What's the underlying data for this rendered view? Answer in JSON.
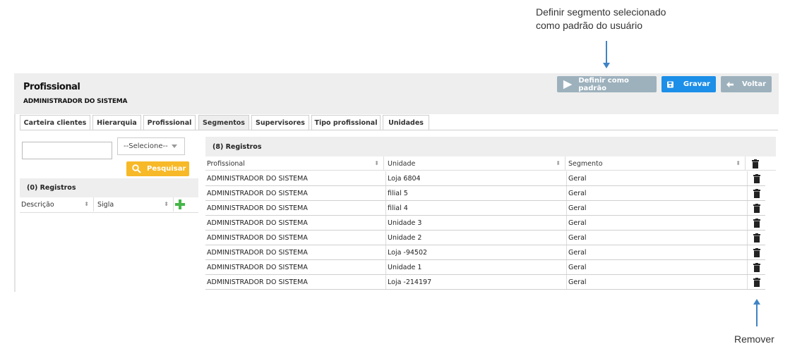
{
  "callouts": {
    "top_line1": "Definir segmento selecionado",
    "top_line2": "como padrão do usuário",
    "bottom": "Remover"
  },
  "header": {
    "title": "Profissional",
    "subtitle": "ADMINISTRADOR DO SISTEMA",
    "buttons": {
      "set_default": "Definir como padrão",
      "save": "Gravar",
      "back": "Voltar"
    }
  },
  "tabs": [
    {
      "label": "Carteira clientes",
      "active": false
    },
    {
      "label": "Hierarquia",
      "active": false
    },
    {
      "label": "Profissional",
      "active": false
    },
    {
      "label": "Segmentos",
      "active": true
    },
    {
      "label": "Supervisores",
      "active": false
    },
    {
      "label": "Tipo profissional",
      "active": false
    },
    {
      "label": "Unidades",
      "active": false
    }
  ],
  "left": {
    "search_value": "",
    "select_value": "--Selecione--",
    "search_button": "Pesquisar",
    "records_label": "(0) Registros",
    "columns": [
      "Descrição",
      "Sigla"
    ]
  },
  "right": {
    "records_label": "(8) Registros",
    "columns": [
      "Profissional",
      "Unidade",
      "Segmento"
    ],
    "rows": [
      {
        "profissional": "ADMINISTRADOR DO SISTEMA",
        "unidade": "Loja 6804",
        "segmento": "Geral"
      },
      {
        "profissional": "ADMINISTRADOR DO SISTEMA",
        "unidade": "filial 5",
        "segmento": "Geral"
      },
      {
        "profissional": "ADMINISTRADOR DO SISTEMA",
        "unidade": "filial 4",
        "segmento": "Geral"
      },
      {
        "profissional": "ADMINISTRADOR DO SISTEMA",
        "unidade": "Unidade 3",
        "segmento": "Geral"
      },
      {
        "profissional": "ADMINISTRADOR DO SISTEMA",
        "unidade": "Unidade 2",
        "segmento": "Geral"
      },
      {
        "profissional": "ADMINISTRADOR DO SISTEMA",
        "unidade": "Loja -94502",
        "segmento": "Geral"
      },
      {
        "profissional": "ADMINISTRADOR DO SISTEMA",
        "unidade": "Unidade 1",
        "segmento": "Geral"
      },
      {
        "profissional": "ADMINISTRADOR DO SISTEMA",
        "unidade": "Loja -214197",
        "segmento": "Geral"
      }
    ]
  },
  "icons": {
    "set_default": "play-icon",
    "save": "floppy-disk-icon",
    "back": "arrow-left-icon",
    "search": "search-icon",
    "add": "plus-icon",
    "remove": "trash-icon",
    "sort": "sort-icon"
  },
  "colors": {
    "primary": "#1c8fe8",
    "secondary": "#9db1bd",
    "search": "#f7b928",
    "add": "#46b648",
    "callout": "#3f84c4"
  }
}
